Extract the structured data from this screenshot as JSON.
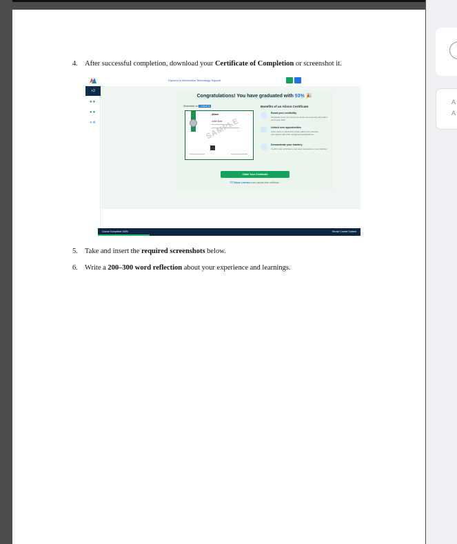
{
  "document": {
    "steps": [
      {
        "num": "4.",
        "pre": "After successful completion, download your ",
        "bold": "Certificate of Completion",
        "post": " or screenshot it."
      },
      {
        "num": "5.",
        "pre": "Take and insert the ",
        "bold": "required screenshots",
        "post": " below."
      },
      {
        "num": "6.",
        "pre": "Write a ",
        "bold": "200–300 word reflection",
        "post": " about your experience and learnings."
      }
    ]
  },
  "screenshot": {
    "breadcrumb": "Diploma in Information Technology Support",
    "sidebar_tab": "+3",
    "congrats_prefix": "Congratulations! You have graduated with ",
    "score": "93%",
    "shareable_on": "Shareable on",
    "linkedin": "Linked in",
    "cert_title": "Alison",
    "cert_name": "John Doe",
    "cert_stamp": "SAMPLE",
    "benefits_title": "Benefits of an Alison Certificate",
    "benefits": [
      {
        "title": "Boost your credibility",
        "desc": "Showcase your commitment to continuous learning and stand out in your field."
      },
      {
        "title": "Unlock new opportunities",
        "desc": "Open doors to advanced career paths and potential promotions with CPD recognised qualifications."
      },
      {
        "title": "Demonstrate your mastery",
        "desc": "Confirm your proficiency and stay competitive in your industry."
      }
    ],
    "claim_button": "Claim Your Certificate",
    "learners_count": "777 Alison Learners",
    "learners_suffix": " have claimed their certificate",
    "footer_left": "Course Completed 100%",
    "footer_right": "Revise Course Content"
  },
  "colors": {
    "accent_green": "#14a35a",
    "accent_blue": "#1b74e4",
    "footer_navy": "#0c2744"
  }
}
